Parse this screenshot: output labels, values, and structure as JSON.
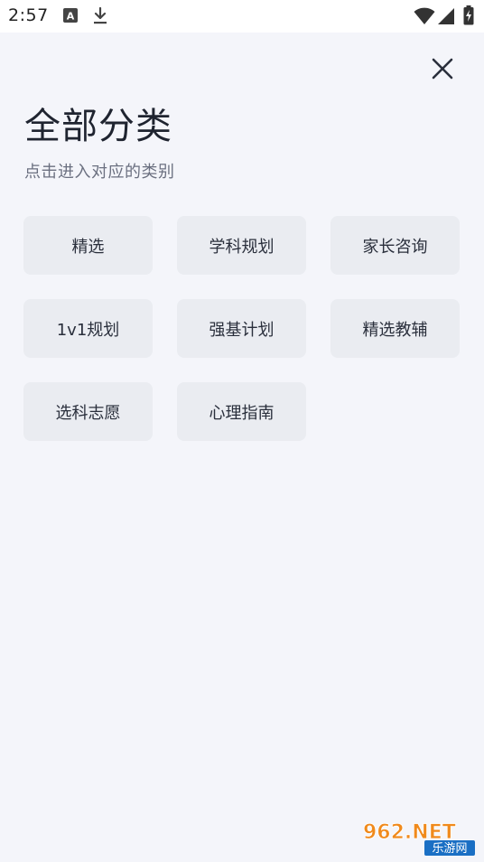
{
  "status_bar": {
    "time": "2:57",
    "icons": [
      "keyboard-a-icon",
      "download-icon",
      "wifi-icon",
      "cell-signal-icon",
      "battery-charging-icon"
    ]
  },
  "header": {
    "close_icon": "close-icon",
    "title": "全部分类",
    "subtitle": "点击进入对应的类别"
  },
  "categories": [
    {
      "label": "精选"
    },
    {
      "label": "学科规划"
    },
    {
      "label": "家长咨询"
    },
    {
      "label": "1v1规划"
    },
    {
      "label": "强基计划"
    },
    {
      "label": "精选教辅"
    },
    {
      "label": "选科志愿"
    },
    {
      "label": "心理指南"
    }
  ],
  "watermark": {
    "text_top": "962.NET",
    "text_bottom": "乐游网"
  },
  "colors": {
    "background": "#f4f5fa",
    "button_bg": "#eaecf1",
    "title": "#1f2430",
    "subtitle": "#6b7080",
    "watermark_orange": "#f08a1c",
    "watermark_blue": "#1a6fc4"
  }
}
